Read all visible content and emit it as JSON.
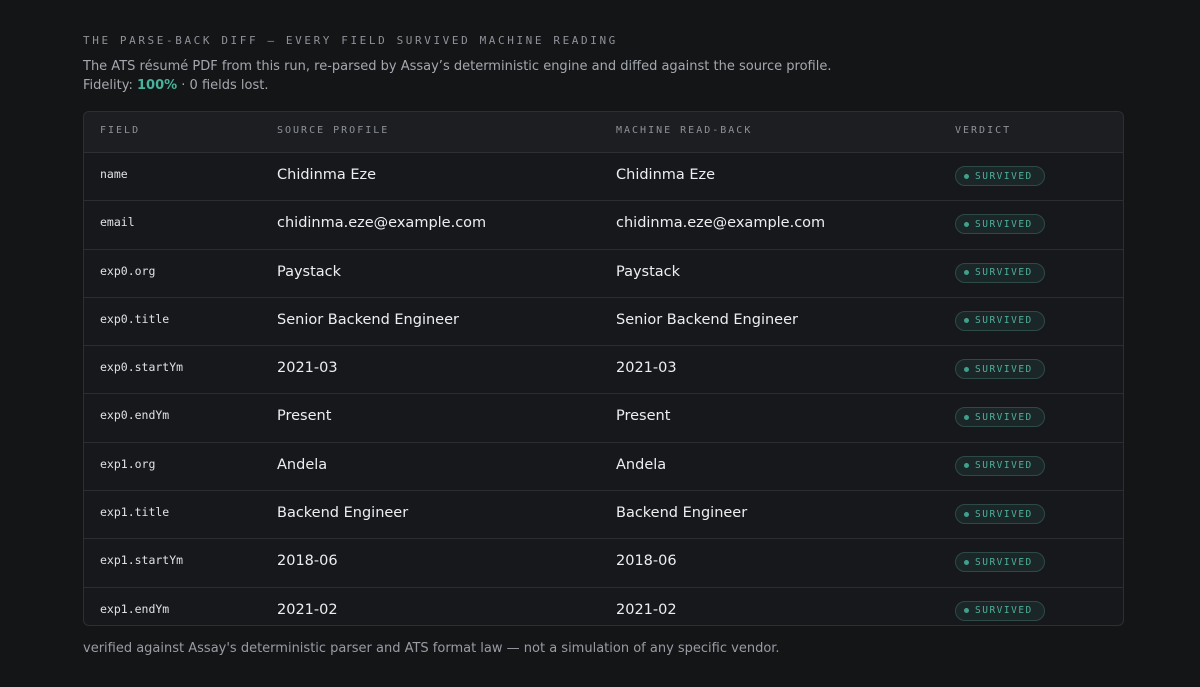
{
  "header": {
    "eyebrow": "THE PARSE-BACK DIFF — EVERY FIELD SURVIVED MACHINE READING",
    "description": "The ATS résumé PDF from this run, re-parsed by Assay’s deterministic engine and diffed against the source profile.",
    "fidelity_label": "Fidelity:",
    "fidelity_value": "100%",
    "fidelity_suffix": "· 0 fields lost."
  },
  "table": {
    "columns": [
      "FIELD",
      "SOURCE PROFILE",
      "MACHINE READ-BACK",
      "VERDICT"
    ],
    "rows": [
      {
        "field": "name",
        "source": "Chidinma Eze",
        "readback": "Chidinma Eze",
        "verdict": "SURVIVED"
      },
      {
        "field": "email",
        "source": "chidinma.eze@example.com",
        "readback": "chidinma.eze@example.com",
        "verdict": "SURVIVED"
      },
      {
        "field": "exp0.org",
        "source": "Paystack",
        "readback": "Paystack",
        "verdict": "SURVIVED"
      },
      {
        "field": "exp0.title",
        "source": "Senior Backend Engineer",
        "readback": "Senior Backend Engineer",
        "verdict": "SURVIVED"
      },
      {
        "field": "exp0.startYm",
        "source": "2021-03",
        "readback": "2021-03",
        "verdict": "SURVIVED"
      },
      {
        "field": "exp0.endYm",
        "source": "Present",
        "readback": "Present",
        "verdict": "SURVIVED"
      },
      {
        "field": "exp1.org",
        "source": "Andela",
        "readback": "Andela",
        "verdict": "SURVIVED"
      },
      {
        "field": "exp1.title",
        "source": "Backend Engineer",
        "readback": "Backend Engineer",
        "verdict": "SURVIVED"
      },
      {
        "field": "exp1.startYm",
        "source": "2018-06",
        "readback": "2018-06",
        "verdict": "SURVIVED"
      },
      {
        "field": "exp1.endYm",
        "source": "2021-02",
        "readback": "2021-02",
        "verdict": "SURVIVED"
      }
    ]
  },
  "footnote": "verified against Assay's deterministic parser and ATS format law — not a simulation of any specific vendor.",
  "colors": {
    "background": "#141517",
    "accent": "#46b49a",
    "badge_border": "#2e4a47"
  }
}
